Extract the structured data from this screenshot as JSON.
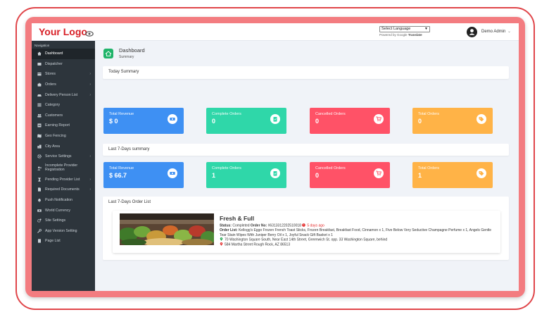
{
  "header": {
    "logo": "Your Logo",
    "language_select": "Select Language",
    "powered_by": "Powered by",
    "google": "Google",
    "translate": "Translate",
    "user_name": "Demo Admin"
  },
  "sidebar": {
    "heading": "Navigation",
    "items": [
      {
        "label": "Dashboard",
        "icon": "home-icon",
        "active": true
      },
      {
        "label": "Dispatcher",
        "icon": "dispatch-icon"
      },
      {
        "label": "Stores",
        "icon": "store-icon",
        "has_children": true
      },
      {
        "label": "Orders",
        "icon": "bag-icon",
        "has_children": true
      },
      {
        "label": "Delivery Person List",
        "icon": "car-icon",
        "has_children": true
      },
      {
        "label": "Category",
        "icon": "list-icon"
      },
      {
        "label": "Customers",
        "icon": "users-icon"
      },
      {
        "label": "Earning Report",
        "icon": "report-icon"
      },
      {
        "label": "Geo Fencing",
        "icon": "map-icon"
      },
      {
        "label": "City Area",
        "icon": "city-icon"
      },
      {
        "label": "Service Settings",
        "icon": "gear-icon",
        "has_children": true
      },
      {
        "label": "Incomplete Provider Registration",
        "icon": "user-x-icon"
      },
      {
        "label": "Pending Provider List",
        "icon": "hourglass-icon",
        "has_children": true
      },
      {
        "label": "Required Documents",
        "icon": "document-icon",
        "has_children": true
      },
      {
        "label": "Push Notification",
        "icon": "bell-icon"
      },
      {
        "label": "World Currency",
        "icon": "money-icon"
      },
      {
        "label": "Site Settings",
        "icon": "cog-icon"
      },
      {
        "label": "App Version Setting",
        "icon": "wrench-icon"
      },
      {
        "label": "Page List",
        "icon": "page-icon"
      }
    ]
  },
  "page": {
    "title": "Dashboard",
    "subtitle": "Summary"
  },
  "today_summary": {
    "title": "Today Summary",
    "cards": [
      {
        "label": "Total Revenue",
        "value": "$ 0",
        "color": "#3e90f3",
        "icon": "money-icon"
      },
      {
        "label": "Complete Orders",
        "value": "0",
        "color": "#2fd7a9",
        "icon": "clipboard-check-icon"
      },
      {
        "label": "Cancelled Orders",
        "value": "0",
        "color": "#ff5267",
        "icon": "cart-cancel-icon"
      },
      {
        "label": "Total Orders",
        "value": "0",
        "color": "#ffb347",
        "icon": "tags-icon"
      }
    ]
  },
  "last7_summary": {
    "title": "Last 7-Days summary",
    "cards": [
      {
        "label": "Total Revenue",
        "value": "$ 66.7",
        "color": "#3e90f3",
        "icon": "money-icon"
      },
      {
        "label": "Complete Orders",
        "value": "1",
        "color": "#2fd7a9",
        "icon": "clipboard-check-icon"
      },
      {
        "label": "Cancelled Orders",
        "value": "0",
        "color": "#ff5267",
        "icon": "cart-cancel-icon"
      },
      {
        "label": "Total Orders",
        "value": "1",
        "color": "#ffb347",
        "icon": "tags-icon"
      }
    ]
  },
  "order_list": {
    "title": "Last 7-Days Order List",
    "orders": [
      {
        "store_name": "Fresh & Full",
        "status_label": "Status:",
        "status": "Completed",
        "order_no_label": "Order No:",
        "order_no": "#6313312202510018",
        "time_ago": "5 days ago",
        "order_list_label": "Order List:",
        "items": "Kellogg's Eggo Frozen French Toast Sticks, Frozen Breakfast, Breakfast Food, Cinnamon x 1, Five Below Very Seductive Champagne Perfume x 1, Angels Gentle Tear Stain Wipes With Juniper Berry Oil x 1, Joyful Snack Gift Basket x 1",
        "pickup_address": "70 Washington Square South, Near East 14th Street, Greenwich St. opp. 33 Washington Square, behind",
        "drop_address": "584 Martha Street Rough Rock, AZ 86513"
      }
    ]
  }
}
